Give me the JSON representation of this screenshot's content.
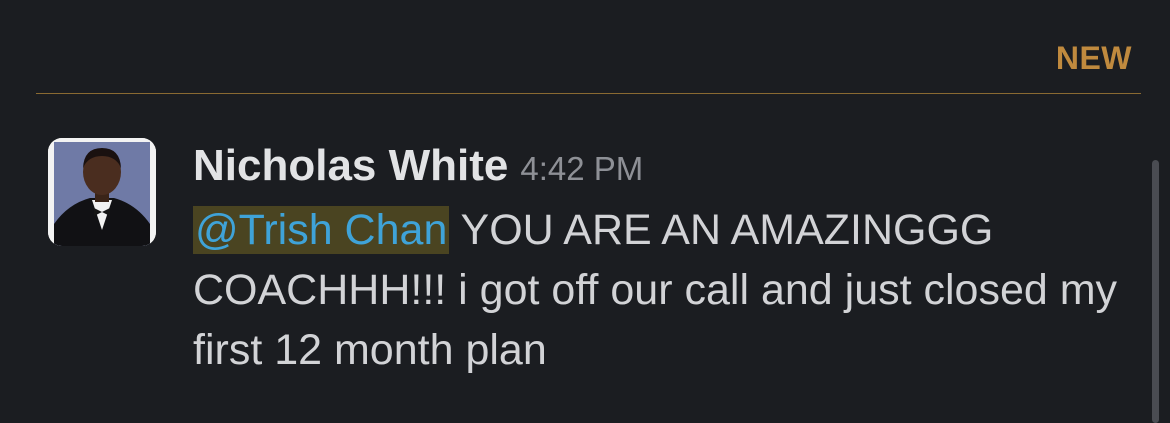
{
  "divider": {
    "label": "NEW"
  },
  "message": {
    "author": "Nicholas White",
    "timestamp": "4:42 PM",
    "mention": "@Trish Chan",
    "text": " YOU ARE AN AMAZINGGG COACHHH!!! i got off our call and just closed my first 12 month plan"
  },
  "colors": {
    "background": "#1b1d21",
    "new_accent": "#c08a3e",
    "mention_text": "#3fa3d8",
    "mention_highlight": "#4a4421"
  }
}
